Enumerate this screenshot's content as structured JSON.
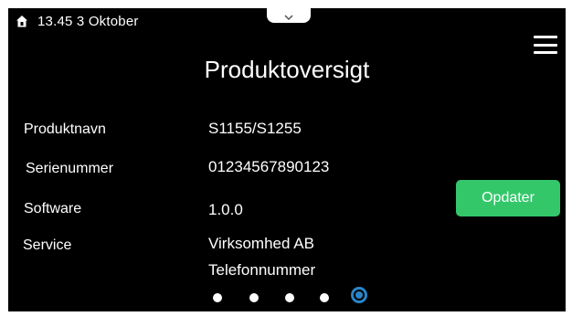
{
  "status_bar": {
    "datetime": "13.45 3 Oktober",
    "home_icon": "home-icon"
  },
  "header": {
    "title": "Produktoversigt",
    "menu_icon": "hamburger-menu-icon"
  },
  "product": {
    "rows": [
      {
        "label": "Produktnavn",
        "value": "S1155/S1255"
      },
      {
        "label": "Serienummer",
        "value": "01234567890123"
      },
      {
        "label": "Software",
        "value": "1.0.0"
      },
      {
        "label": "Service",
        "value": "Virksomhed AB",
        "value2": "Telefonnummer"
      }
    ],
    "update_button_label": "Opdater"
  },
  "pager": {
    "total": 5,
    "active_index": 4
  },
  "colors": {
    "background": "#000000",
    "text": "#ffffff",
    "update_button": "#33c76a",
    "active_dot": "#2a84c8"
  }
}
